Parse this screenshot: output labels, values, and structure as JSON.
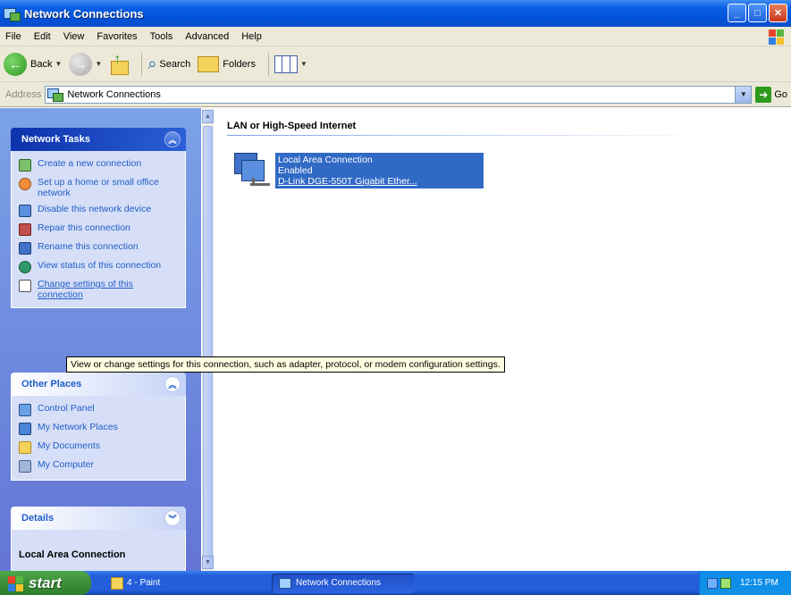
{
  "window": {
    "title": "Network Connections"
  },
  "menu": [
    "File",
    "Edit",
    "View",
    "Favorites",
    "Tools",
    "Advanced",
    "Help"
  ],
  "toolbar": {
    "back": "Back",
    "search": "Search",
    "folders": "Folders"
  },
  "address": {
    "label": "Address",
    "value": "Network Connections",
    "go": "Go"
  },
  "network_tasks": {
    "title": "Network Tasks",
    "items": [
      "Create a new connection",
      "Set up a home or small office network",
      "Disable this network device",
      "Repair this connection",
      "Rename this connection",
      "View status of this connection",
      "Change settings of this connection"
    ]
  },
  "other_places": {
    "title": "Other Places",
    "items": [
      "Control Panel",
      "My Network Places",
      "My Documents",
      "My Computer"
    ]
  },
  "details": {
    "title": "Details",
    "name": "Local Area Connection"
  },
  "tooltip": "View or change settings for this connection, such as adapter, protocol, or modem configuration settings.",
  "content": {
    "group": "LAN or High-Speed Internet",
    "connection": {
      "name": "Local Area Connection",
      "status": "Enabled",
      "device": "D-Link DGE-550T Gigabit Ether..."
    }
  },
  "taskbar": {
    "start": "start",
    "quick": "4 - Paint",
    "task": "Network Connections",
    "clock": "12:15 PM"
  },
  "colors": {
    "titlebar": "#0a5ee6",
    "taskpane": "#6375d6",
    "selection": "#316ac5",
    "start": "#3c8f38"
  }
}
